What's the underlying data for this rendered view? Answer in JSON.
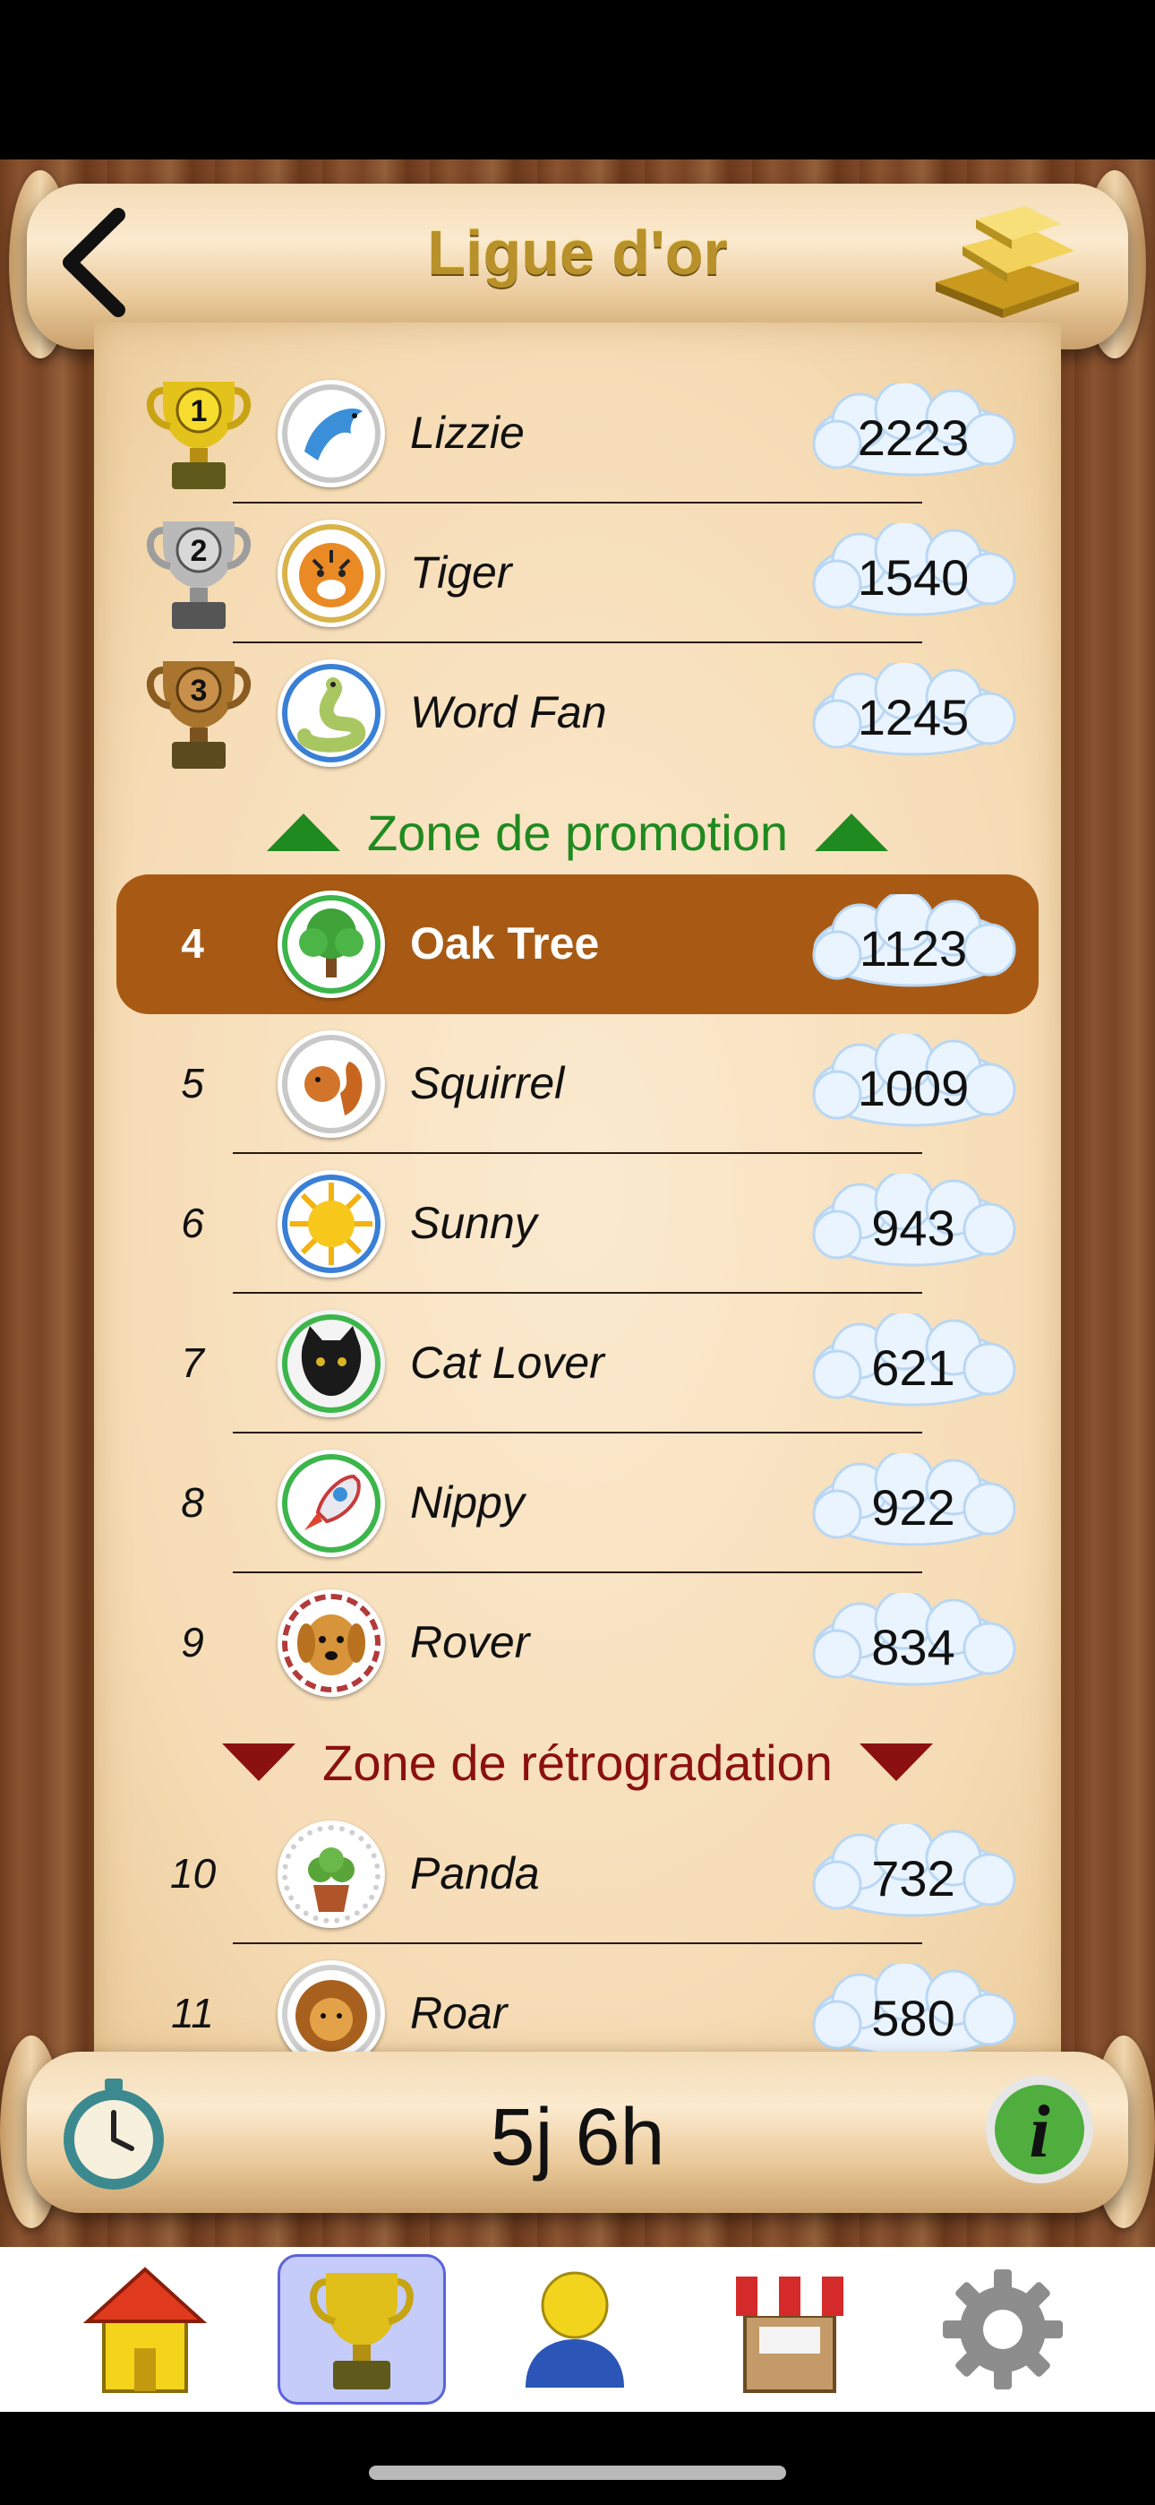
{
  "header": {
    "title": "Ligue d'or",
    "back_icon": "chevron-left-icon",
    "badge_icon": "gold-bars-icon"
  },
  "players_top": [
    {
      "rank": "1",
      "name": "Lizzie",
      "score": "2223",
      "avatar": "dolphin-avatar",
      "ring": "#c8c8c8"
    },
    {
      "rank": "2",
      "name": "Tiger",
      "score": "1540",
      "avatar": "tiger-avatar",
      "ring": "#d9b24a"
    },
    {
      "rank": "3",
      "name": "Word Fan",
      "score": "1245",
      "avatar": "worm-avatar",
      "ring": "#3a7fd6"
    }
  ],
  "promotion_zone_label": "Zone de promotion",
  "current_player": {
    "rank": "4",
    "name": "Oak Tree",
    "score": "1123",
    "avatar": "tree-avatar",
    "ring": "#3cb54a"
  },
  "players_mid": [
    {
      "rank": "5",
      "name": "Squirrel",
      "score": "1009",
      "avatar": "squirrel-avatar",
      "ring": "#c8c8c8"
    },
    {
      "rank": "6",
      "name": "Sunny",
      "score": "943",
      "avatar": "sun-avatar",
      "ring": "#3a7fd6"
    },
    {
      "rank": "7",
      "name": "Cat Lover",
      "score": "621",
      "avatar": "cat-avatar",
      "ring": "#3cb54a"
    },
    {
      "rank": "8",
      "name": "Nippy",
      "score": "922",
      "avatar": "rocket-avatar",
      "ring": "#3cb54a"
    },
    {
      "rank": "9",
      "name": "Rover",
      "score": "834",
      "avatar": "dog-avatar",
      "ring": "#b33a3a"
    }
  ],
  "demotion_zone_label": "Zone de rétrogradation",
  "players_bottom": [
    {
      "rank": "10",
      "name": "Panda",
      "score": "732",
      "avatar": "plant-avatar",
      "ring": "#d0d0d0"
    },
    {
      "rank": "11",
      "name": "Roar",
      "score": "580",
      "avatar": "lion-avatar",
      "ring": "#d0d0d0"
    }
  ],
  "footer": {
    "timer": "5j 6h",
    "clock_icon": "stopwatch-icon",
    "info_icon": "info-icon"
  },
  "nav": [
    {
      "icon": "home-icon",
      "active": false
    },
    {
      "icon": "trophy-icon",
      "active": true
    },
    {
      "icon": "profile-icon",
      "active": false
    },
    {
      "icon": "shop-icon",
      "active": false
    },
    {
      "icon": "settings-gear-icon",
      "active": false
    }
  ],
  "colors": {
    "promotion": "#1f8a1f",
    "demotion": "#8b1010",
    "highlight": "#a85a14",
    "title_gold": "#b8912a"
  }
}
